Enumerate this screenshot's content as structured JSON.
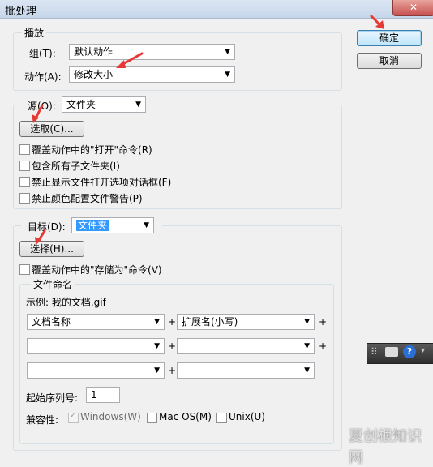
{
  "window": {
    "title": "批处理",
    "close": "✕"
  },
  "buttons": {
    "ok": "确定",
    "cancel": "取消"
  },
  "play": {
    "legend": "播放",
    "group_label": "组(T):",
    "group_value": "默认动作",
    "action_label": "动作(A):",
    "action_value": "修改大小"
  },
  "source": {
    "label": "源(O):",
    "value": "文件夹",
    "choose": "选取(C)...",
    "options": [
      "覆盖动作中的\"打开\"命令(R)",
      "包含所有子文件夹(I)",
      "禁止显示文件打开选项对话框(F)",
      "禁止颜色配置文件警告(P)"
    ]
  },
  "target": {
    "label": "目标(D):",
    "value": "文件夹",
    "choose": "选择(H)...",
    "override": "覆盖动作中的\"存储为\"命令(V)"
  },
  "naming": {
    "legend": "文件命名",
    "example": "示例: 我的文档.gif",
    "rows": [
      [
        "文档名称",
        "扩展名(小写)"
      ],
      [
        "",
        ""
      ],
      [
        "",
        ""
      ]
    ],
    "plus": "+",
    "serial_label": "起始序列号:",
    "serial_value": "1",
    "compat_label": "兼容性:",
    "compat": [
      "Windows(W)",
      "Mac OS(M)",
      "Unix(U)"
    ]
  },
  "watermark": "夏创根知识网",
  "annotation_color": "#e53935"
}
